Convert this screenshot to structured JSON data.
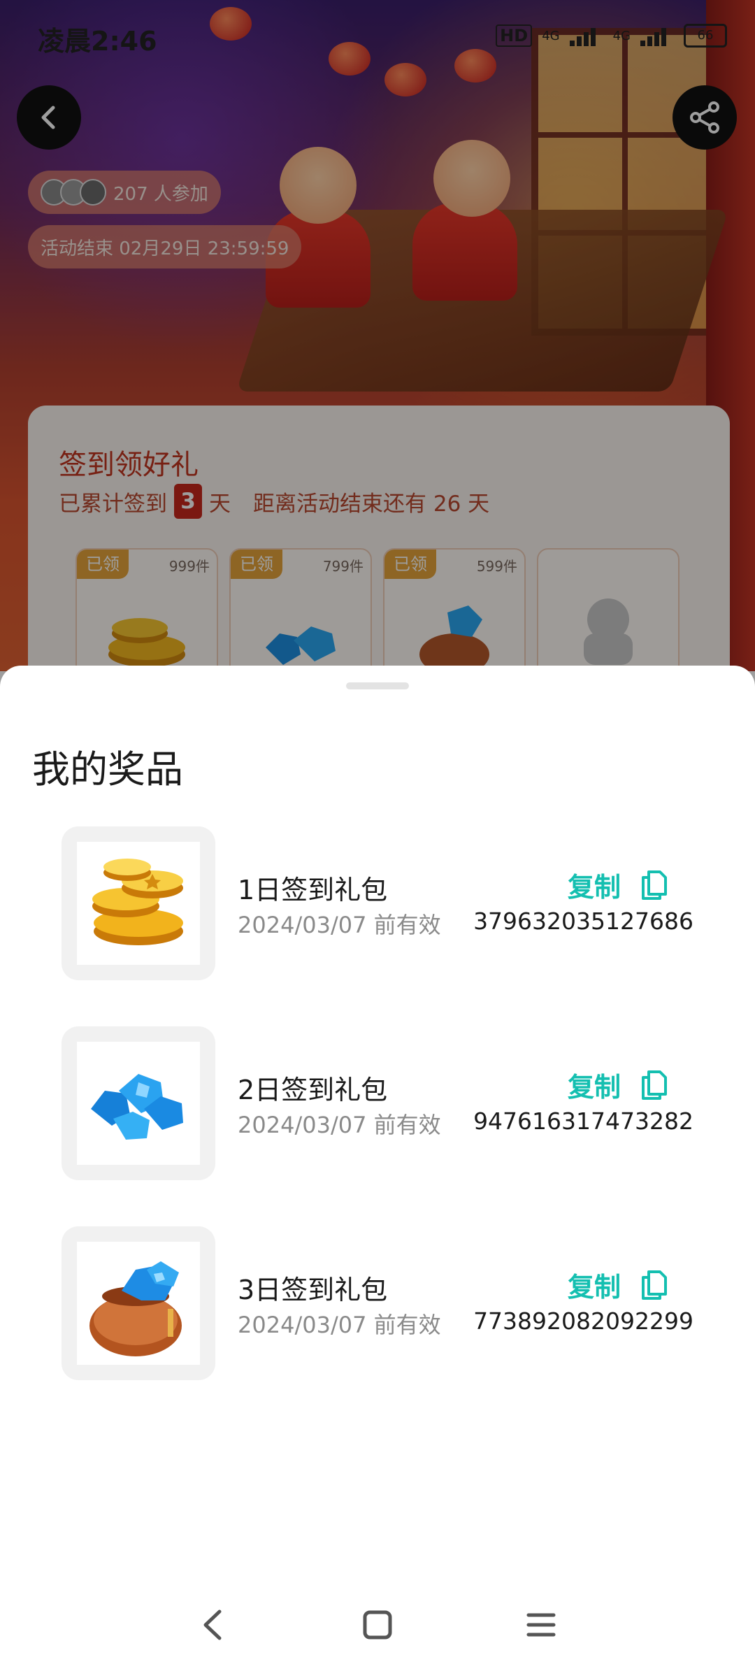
{
  "status_bar": {
    "time": "凌晨2:46",
    "net_type": "HD",
    "signal_1": "4G",
    "signal_2": "4G",
    "battery": "66"
  },
  "header": {
    "back_icon": "chevron-left-icon",
    "share_icon": "share-icon",
    "participants": "207 人参加",
    "end_time": "活动结束 02月29日 23:59:59"
  },
  "card": {
    "title": "签到领好礼",
    "sub_prefix": "已累计签到",
    "days_signed": "3",
    "sub_unit": "天",
    "remaining": "距离活动结束还有 26 天",
    "gifts": [
      {
        "tag": "已领",
        "count": "999件",
        "icon": "gold-coins-icon"
      },
      {
        "tag": "已领",
        "count": "799件",
        "icon": "blue-gems-icon"
      },
      {
        "tag": "已领",
        "count": "599件",
        "icon": "gem-bag-icon"
      },
      {
        "tag": "",
        "count": "",
        "icon": "mystery-gift-icon"
      }
    ]
  },
  "sheet": {
    "title": "我的奖品",
    "prizes": [
      {
        "name": "1日签到礼包",
        "valid": "2024/03/07 前有效",
        "copy_label": "复制",
        "code": "379632035127686",
        "icon": "gold-coins-icon"
      },
      {
        "name": "2日签到礼包",
        "valid": "2024/03/07 前有效",
        "copy_label": "复制",
        "code": "947616317473282",
        "icon": "blue-gems-icon"
      },
      {
        "name": "3日签到礼包",
        "valid": "2024/03/07 前有效",
        "copy_label": "复制",
        "code": "773892082092299",
        "icon": "gem-bag-icon"
      }
    ]
  },
  "nav": {
    "back_icon": "nav-back-icon",
    "home_icon": "nav-home-icon",
    "menu_icon": "nav-menu-icon"
  },
  "colors": {
    "accent": "#14bfb0",
    "card_red": "#c0351f",
    "tag_gold": "#e5a43a"
  }
}
